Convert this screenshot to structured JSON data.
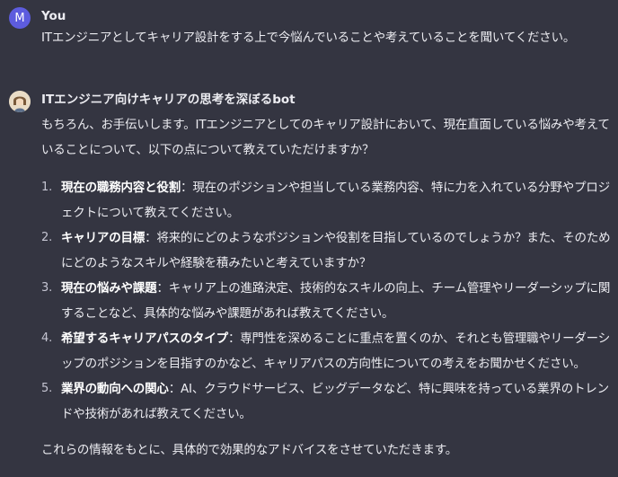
{
  "user_message": {
    "avatar_letter": "M",
    "author": "You",
    "text": "ITエンジニアとしてキャリア設計をする上で今悩んでいることや考えていることを聞いてください。"
  },
  "bot_message": {
    "avatar_icon": "bot-avatar-icon",
    "author": "ITエンジニア向けキャリアの思考を深ぼるbot",
    "intro": "もちろん、お手伝いします。ITエンジニアとしてのキャリア設計において、現在直面している悩みや考えていることについて、以下の点について教えていただけますか？",
    "points": [
      {
        "number": "1.",
        "term": "現在の職務内容と役割",
        "sep": "：",
        "text": "現在のポジションや担当している業務内容、特に力を入れている分野やプロジェクトについて教えてください。"
      },
      {
        "number": "2.",
        "term": "キャリアの目標",
        "sep": "：",
        "text": "将来的にどのようなポジションや役割を目指しているのでしょうか？また、そのためにどのようなスキルや経験を積みたいと考えていますか？"
      },
      {
        "number": "3.",
        "term": "現在の悩みや課題",
        "sep": "：",
        "text": "キャリア上の進路決定、技術的なスキルの向上、チーム管理やリーダーシップに関することなど、具体的な悩みや課題があれば教えてください。"
      },
      {
        "number": "4.",
        "term": "希望するキャリアパスのタイプ",
        "sep": "：",
        "text": "専門性を深めることに重点を置くのか、それとも管理職やリーダーシップのポジションを目指すのかなど、キャリアパスの方向性についての考えをお聞かせください。"
      },
      {
        "number": "5.",
        "term": "業界の動向への関心",
        "sep": "：",
        "text": "AI、クラウドサービス、ビッグデータなど、特に興味を持っている業界のトレンドや技術があれば教えてください。"
      }
    ],
    "closing": "これらの情報をもとに、具体的で効果的なアドバイスをさせていただきます。"
  },
  "colors": {
    "background": "#343541",
    "text": "#ececf1",
    "user_avatar": "#5d5cde"
  }
}
